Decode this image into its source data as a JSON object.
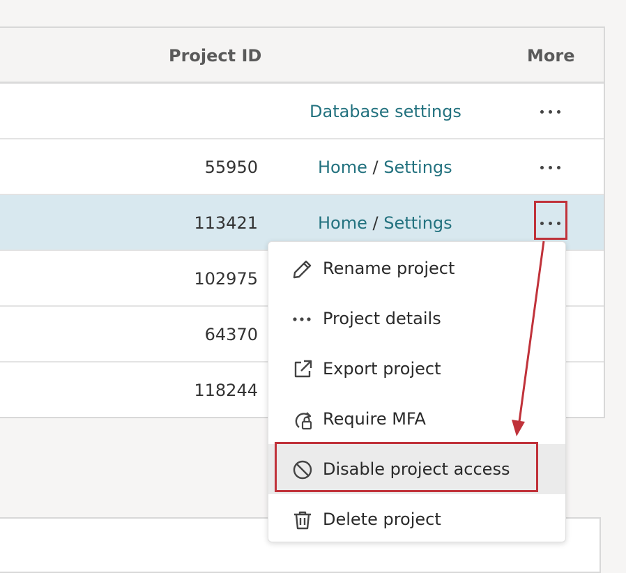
{
  "table": {
    "headers": {
      "project_id": "Project ID",
      "more": "More"
    },
    "rows": [
      {
        "project_id": "",
        "link1": "Database settings",
        "sep": "",
        "link2": ""
      },
      {
        "project_id": "55950",
        "link1": "Home",
        "sep": " / ",
        "link2": "Settings"
      },
      {
        "project_id": "113421",
        "link1": "Home",
        "sep": " / ",
        "link2": "Settings"
      },
      {
        "project_id": "102975",
        "link1": "",
        "sep": "",
        "link2": ""
      },
      {
        "project_id": "64370",
        "link1": "",
        "sep": "",
        "link2": ""
      },
      {
        "project_id": "118244",
        "link1": "",
        "sep": "",
        "link2": ""
      }
    ]
  },
  "menu": {
    "items": [
      {
        "label": "Rename project",
        "icon": "pencil-icon"
      },
      {
        "label": "Project details",
        "icon": "dots-icon"
      },
      {
        "label": "Export project",
        "icon": "external-link-icon"
      },
      {
        "label": "Require MFA",
        "icon": "refresh-lock-icon"
      },
      {
        "label": "Disable project access",
        "icon": "ban-icon"
      },
      {
        "label": "Delete project",
        "icon": "trash-icon"
      }
    ]
  },
  "colors": {
    "link": "#23727f",
    "selected_row": "#d8e8ef",
    "annotation": "#c0323a",
    "menu_hover": "#ebebeb"
  }
}
